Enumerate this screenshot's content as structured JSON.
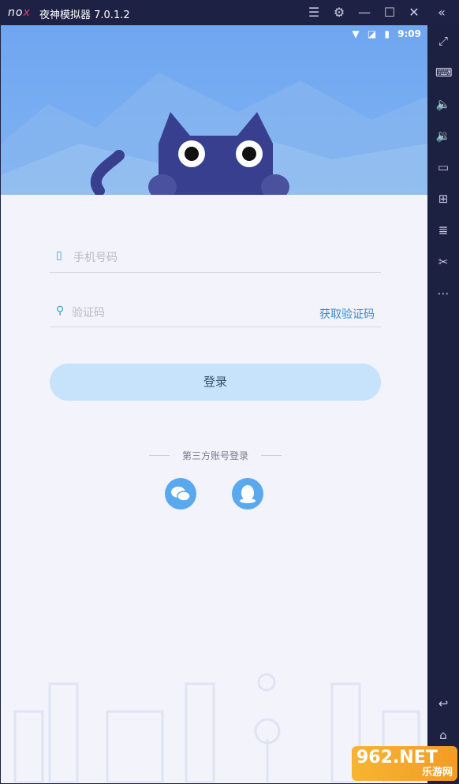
{
  "titlebar": {
    "logo": "nox",
    "title": "夜神模拟器 7.0.1.2"
  },
  "status": {
    "time": "9:09"
  },
  "form": {
    "phone_placeholder": "手机号码",
    "code_placeholder": "验证码",
    "get_code": "获取验证码",
    "login": "登录"
  },
  "third_party": {
    "label": "第三方账号登录"
  },
  "watermark": {
    "brand": "962.NET",
    "text": "乐游网"
  },
  "colors": {
    "accent": "#5aa9ee",
    "header": "#72a9f1",
    "cat": "#383f8e"
  }
}
